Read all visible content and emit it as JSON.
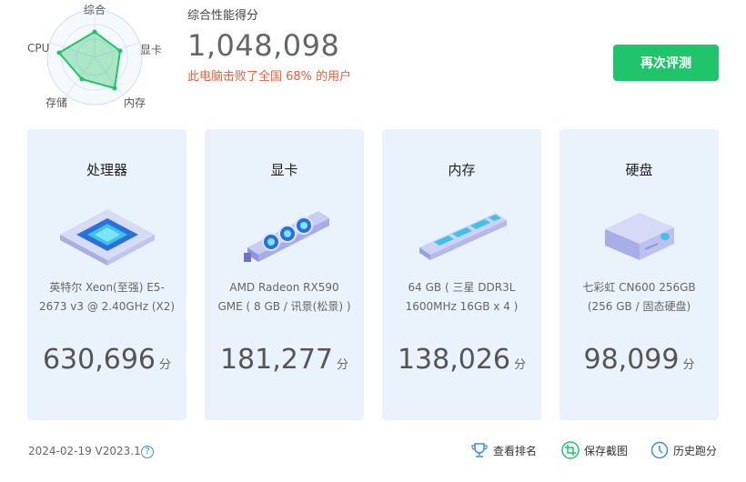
{
  "radar": {
    "labels": {
      "top": "综合",
      "right": "显卡",
      "bottom_right": "内存",
      "bottom_left": "存储",
      "left": "CPU"
    },
    "accent_color": "#20c46b"
  },
  "summary": {
    "title": "综合性能得分",
    "total_score": "1,048,098",
    "beat_text": "此电脑击败了全国 68% 的用户"
  },
  "actions": {
    "retest_label": "再次评测",
    "rank_label": "查看排名",
    "screenshot_label": "保存截图",
    "history_label": "历史跑分"
  },
  "cards": [
    {
      "title": "处理器",
      "spec": "英特尔 Xeon(至强) E5-2673 v3 @ 2.40GHz (X2)",
      "score": "630,696",
      "unit": "分",
      "icon": "cpu-icon"
    },
    {
      "title": "显卡",
      "spec": "AMD Radeon RX590 GME ( 8 GB / 讯景(松景) )",
      "score": "181,277",
      "unit": "分",
      "icon": "gpu-icon"
    },
    {
      "title": "内存",
      "spec": "64 GB ( 三星 DDR3L 1600MHz 16GB x 4 )",
      "score": "138,026",
      "unit": "分",
      "icon": "ram-icon"
    },
    {
      "title": "硬盘",
      "spec": "七彩虹 CN600 256GB (256 GB / 固态硬盘)",
      "score": "98,099",
      "unit": "分",
      "icon": "disk-icon"
    }
  ],
  "footer": {
    "version": "2024-02-19 V2023.1",
    "help_icon": "question-icon"
  },
  "colors": {
    "card_bg": "#eaf2fb",
    "button_green": "#20c46b",
    "beat_text": "#e8603c",
    "icon_blue": "#3a8ee6"
  }
}
